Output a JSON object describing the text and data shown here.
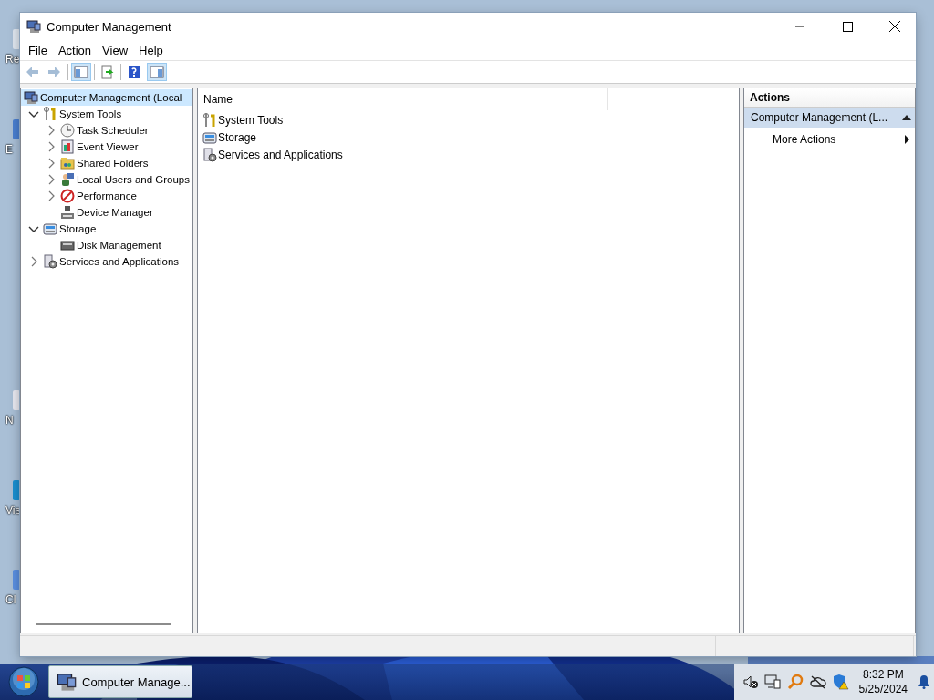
{
  "desktop_icons": [
    {
      "label": "Re"
    },
    {
      "label": "E"
    },
    {
      "label": "N"
    },
    {
      "label": "Vis"
    },
    {
      "label": "Cl"
    }
  ],
  "window": {
    "title": "Computer Management"
  },
  "menu": [
    "File",
    "Action",
    "View",
    "Help"
  ],
  "toolbar": [
    {
      "kind": "back",
      "disabled": true,
      "pressed": false
    },
    {
      "kind": "forward",
      "disabled": true,
      "pressed": false
    },
    {
      "kind": "tree",
      "disabled": false,
      "pressed": true
    },
    {
      "kind": "export",
      "disabled": false,
      "pressed": false
    },
    {
      "kind": "help",
      "disabled": false,
      "pressed": false
    },
    {
      "kind": "pane",
      "disabled": false,
      "pressed": true
    }
  ],
  "tree": [
    {
      "kind": "computer",
      "label": "Computer Management (Local",
      "selected": true,
      "children": [
        {
          "kind": "tools",
          "label": "System Tools",
          "selected": false,
          "expanded": true,
          "children": [
            {
              "kind": "clock",
              "label": "Task Scheduler",
              "selected": false,
              "expanded": false
            },
            {
              "kind": "log",
              "label": "Event Viewer",
              "selected": false,
              "expanded": false
            },
            {
              "kind": "share",
              "label": "Shared Folders",
              "selected": false,
              "expanded": false
            },
            {
              "kind": "users",
              "label": "Local Users and Groups",
              "selected": false,
              "expanded": false
            },
            {
              "kind": "perf",
              "label": "Performance",
              "selected": false,
              "expanded": false
            },
            {
              "kind": "device",
              "label": "Device Manager",
              "selected": false
            }
          ]
        },
        {
          "kind": "storage",
          "label": "Storage",
          "selected": false,
          "expanded": true,
          "children": [
            {
              "kind": "disk",
              "label": "Disk Management",
              "selected": false
            }
          ]
        },
        {
          "kind": "services",
          "label": "Services and Applications",
          "selected": false,
          "expanded": false
        }
      ]
    }
  ],
  "list": {
    "columns": [
      "Name"
    ],
    "rows": [
      {
        "kind": "tools",
        "name": "System Tools"
      },
      {
        "kind": "storage",
        "name": "Storage"
      },
      {
        "kind": "services",
        "name": "Services and Applications"
      }
    ]
  },
  "actions": {
    "title": "Actions",
    "section": {
      "label": "Computer Management (L...",
      "expanded": true
    },
    "items": [
      {
        "label": "More Actions"
      }
    ]
  },
  "taskbar": {
    "tasks": [
      {
        "label": "Computer Manage...",
        "selected": true
      }
    ],
    "time": "8:32 PM",
    "date": "5/25/2024"
  }
}
